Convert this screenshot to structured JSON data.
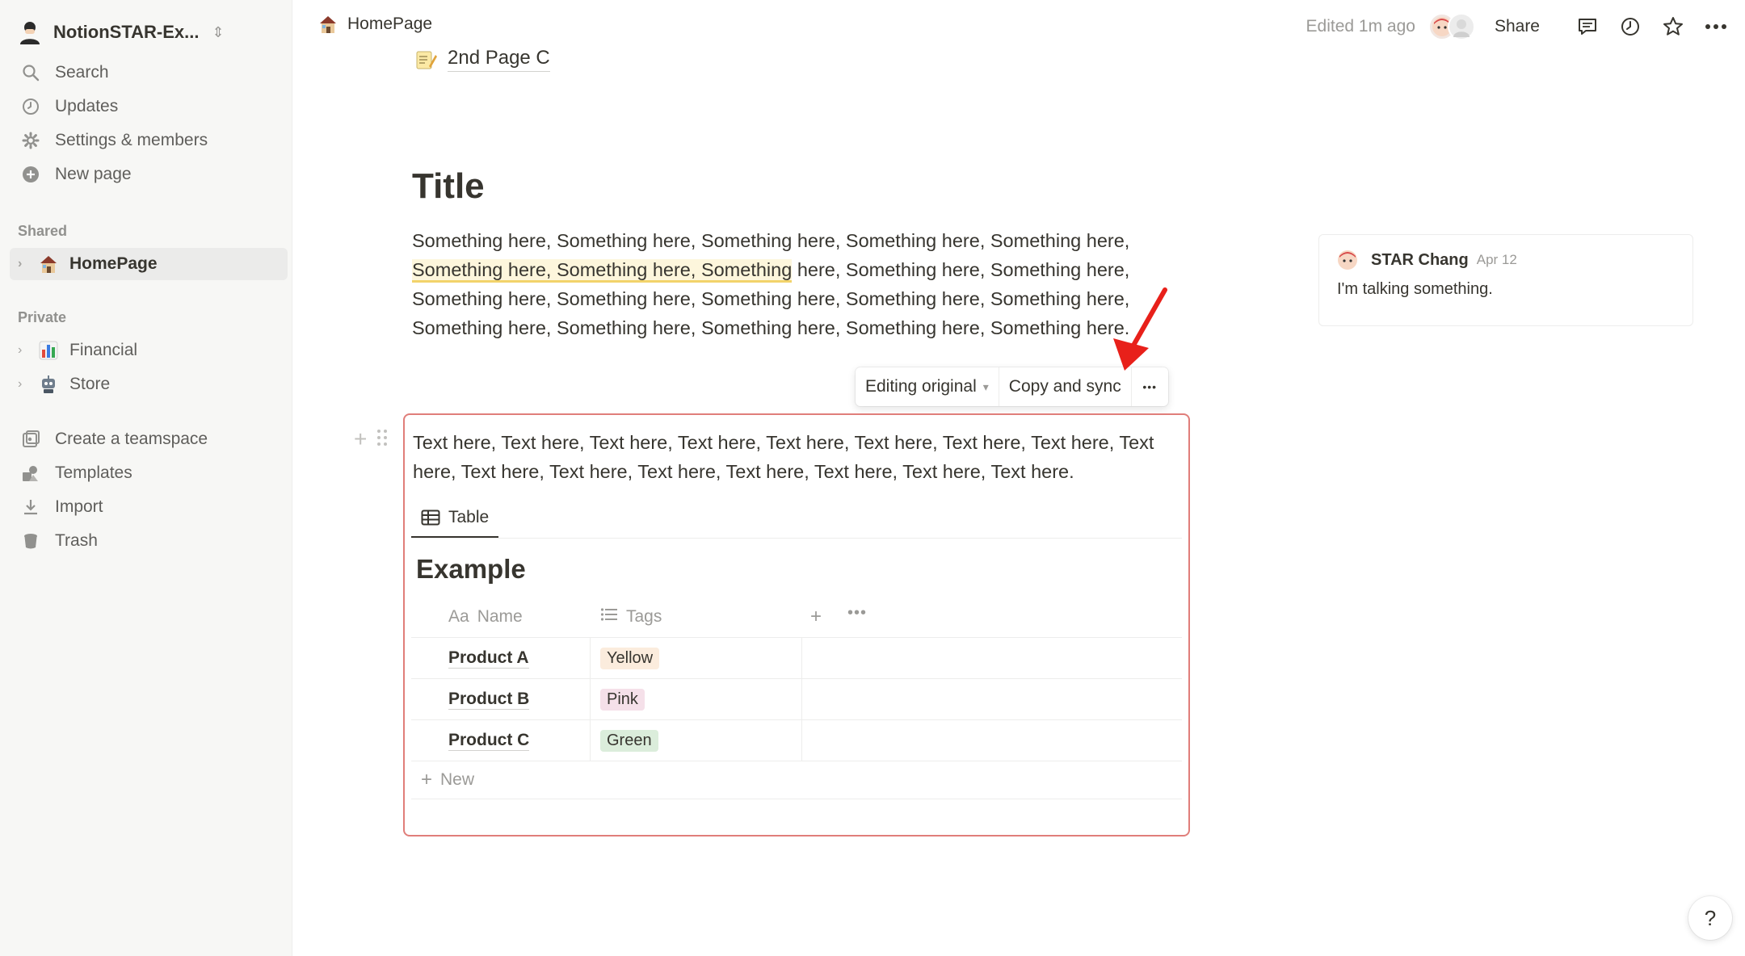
{
  "workspace": {
    "name": "NotionSTAR-Ex..."
  },
  "sidebar": {
    "nav": [
      {
        "label": "Search",
        "icon": "search-icon"
      },
      {
        "label": "Updates",
        "icon": "clock-icon"
      },
      {
        "label": "Settings & members",
        "icon": "gear-icon"
      },
      {
        "label": "New page",
        "icon": "plus-circle-icon"
      }
    ],
    "shared_heading": "Shared",
    "shared_pages": [
      {
        "label": "HomePage",
        "icon": "house-emoji"
      }
    ],
    "private_heading": "Private",
    "private_pages": [
      {
        "label": "Financial",
        "icon": "bar-chart-emoji"
      },
      {
        "label": "Store",
        "icon": "robot-emoji"
      }
    ],
    "bottom": [
      {
        "label": "Create a teamspace",
        "icon": "teamspace-icon"
      },
      {
        "label": "Templates",
        "icon": "templates-icon"
      },
      {
        "label": "Import",
        "icon": "import-icon"
      },
      {
        "label": "Trash",
        "icon": "trash-icon"
      }
    ]
  },
  "topbar": {
    "breadcrumb": "HomePage",
    "edited": "Edited 1m ago",
    "share": "Share"
  },
  "page": {
    "linked_page": "2nd Page C",
    "title": "Title",
    "para_highlight": "Something here, Something here, Something",
    "para_before": "Something here, Something here, Something here, Something here, Something here, ",
    "para_after": " here, Something here, Something here, Something here, Something here, Something here, Something here, Something here, Something here, Something here, Something here, Something here, Something here."
  },
  "sync_toolbar": {
    "editing": "Editing original",
    "copy_sync": "Copy and sync",
    "more": "•••"
  },
  "synced_block": {
    "text": "Text here, Text here, Text here, Text here, Text here, Text here, Text here, Text here, Text here, Text here, Text here, Text here, Text here, Text here, Text here, Text here.",
    "view_tab": "Table",
    "db_title": "Example",
    "columns": {
      "name": "Name",
      "name_prefix": "Aa",
      "tags": "Tags"
    },
    "rows": [
      {
        "name": "Product A",
        "tag": "Yellow",
        "tag_color": "#fbecdd"
      },
      {
        "name": "Product B",
        "tag": "Pink",
        "tag_color": "#f5e0e9"
      },
      {
        "name": "Product C",
        "tag": "Green",
        "tag_color": "#dbeddb"
      }
    ],
    "new_label": "New"
  },
  "comment": {
    "author": "STAR Chang",
    "date": "Apr 12",
    "body": "I'm talking something."
  },
  "help": "?",
  "colors": {
    "accent_border": "#e07e7a",
    "arrow": "#e8201a"
  }
}
